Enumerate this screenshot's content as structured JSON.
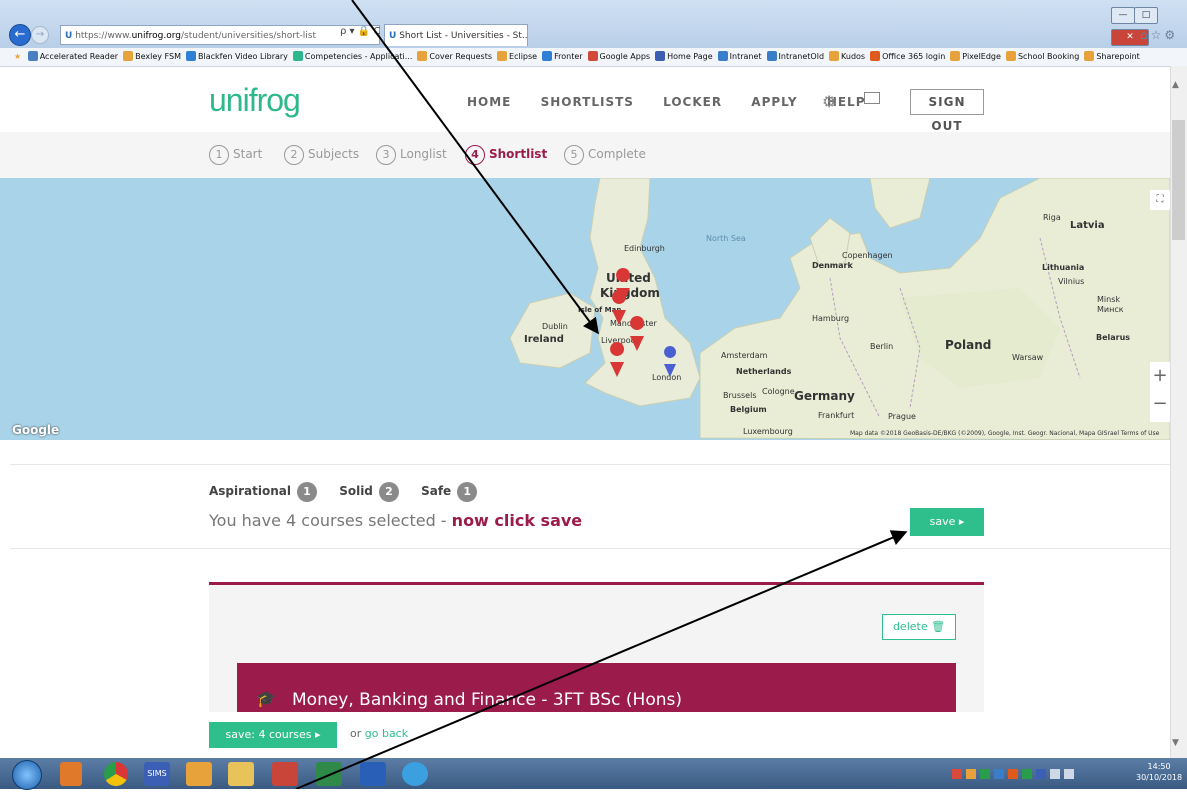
{
  "browser": {
    "url_scheme_icon": "U",
    "url_prefix": "https://www.",
    "url_host": "unifrog.org",
    "url_path": "/student/universities/short-list",
    "tab_title": "Short List - Universities - St...",
    "tab_close": "×",
    "addr_icons": "ρ ▾ 🔒 C"
  },
  "favorites": [
    {
      "label": "Accelerated Reader",
      "color": "#4a7fc1"
    },
    {
      "label": "Bexley FSM",
      "color": "#e8a23c"
    },
    {
      "label": "Blackfen Video Library",
      "color": "#2f7fd4"
    },
    {
      "label": "Competencies - Applicati...",
      "color": "#2eb88c"
    },
    {
      "label": "Cover Requests",
      "color": "#e8a23c"
    },
    {
      "label": "Eclipse",
      "color": "#e8a23c"
    },
    {
      "label": "Fronter",
      "color": "#2f7fd4"
    },
    {
      "label": "Google Apps",
      "color": "#d24a3a"
    },
    {
      "label": "Home Page",
      "color": "#3a5fb5"
    },
    {
      "label": "Intranet",
      "color": "#3a7dc9"
    },
    {
      "label": "IntranetOld",
      "color": "#3a7dc9"
    },
    {
      "label": "Kudos",
      "color": "#e8a23c"
    },
    {
      "label": "Office 365 login",
      "color": "#e05a1e"
    },
    {
      "label": "PixelEdge",
      "color": "#e8a23c"
    },
    {
      "label": "School Booking",
      "color": "#e8a23c"
    },
    {
      "label": "Sharepoint",
      "color": "#e8a23c"
    }
  ],
  "header": {
    "logo": "unifrog",
    "nav": [
      "HOME",
      "SHORTLISTS",
      "LOCKER",
      "APPLY",
      "HELP"
    ],
    "signout": "SIGN OUT"
  },
  "steps": [
    {
      "num": "1",
      "label": "Start"
    },
    {
      "num": "2",
      "label": "Subjects"
    },
    {
      "num": "3",
      "label": "Longlist"
    },
    {
      "num": "4",
      "label": "Shortlist"
    },
    {
      "num": "5",
      "label": "Complete"
    }
  ],
  "map": {
    "labels": {
      "edinburgh": "Edinburgh",
      "north_sea": "North Sea",
      "united": "United",
      "kingdom": "Kingdom",
      "isle_of_man": "Isle of Man",
      "manchester": "Manchester",
      "dublin": "Dublin",
      "ireland": "Ireland",
      "liverpool": "Liverpool",
      "london": "London",
      "amsterdam": "Amsterdam",
      "netherlands": "Netherlands",
      "brussels": "Brussels",
      "cologne": "Cologne",
      "belgium": "Belgium",
      "germany": "Germany",
      "frankfurt": "Frankfurt",
      "luxembourg": "Luxembourg",
      "prague": "Prague",
      "hamburg": "Hamburg",
      "berlin": "Berlin",
      "poland": "Poland",
      "warsaw": "Warsaw",
      "denmark": "Denmark",
      "copenhagen": "Copenhagen",
      "riga": "Riga",
      "latvia": "Latvia",
      "lithuania": "Lithuania",
      "vilnius": "Vilnius",
      "minsk": "Minsk",
      "minsk_cyr": "Минск",
      "belarus": "Belarus"
    },
    "google": "Google",
    "attribution": "Map data ©2018 GeoBasis-DE/BKG (©2009), Google, Inst. Geogr. Nacional, Mapa GISrael   Terms of Use",
    "zoom_in": "+",
    "zoom_out": "−",
    "fullscreen": "⛶"
  },
  "summary": {
    "aspirational_label": "Aspirational",
    "aspirational_count": "1",
    "solid_label": "Solid",
    "solid_count": "2",
    "safe_label": "Safe",
    "safe_count": "1",
    "selected_prefix": "You have 4 courses selected - ",
    "selected_cta": "now click save",
    "save_label": "save ▸"
  },
  "course": {
    "delete_label": "delete 🗑",
    "title": "Money, Banking and Finance - 3FT BSc (Hons)"
  },
  "footer": {
    "save_courses": "save: 4 courses ▸",
    "or_text": "or ",
    "go_back": "go back"
  },
  "taskbar": {
    "clock_time": "14:50",
    "clock_date": "30/10/2018",
    "sims_label": "SIMS"
  },
  "colors": {
    "brand_green": "#2ebf8c",
    "brand_maroon": "#9b1b4b",
    "marker_red": "#d93636",
    "marker_blue": "#4a5fd1"
  }
}
